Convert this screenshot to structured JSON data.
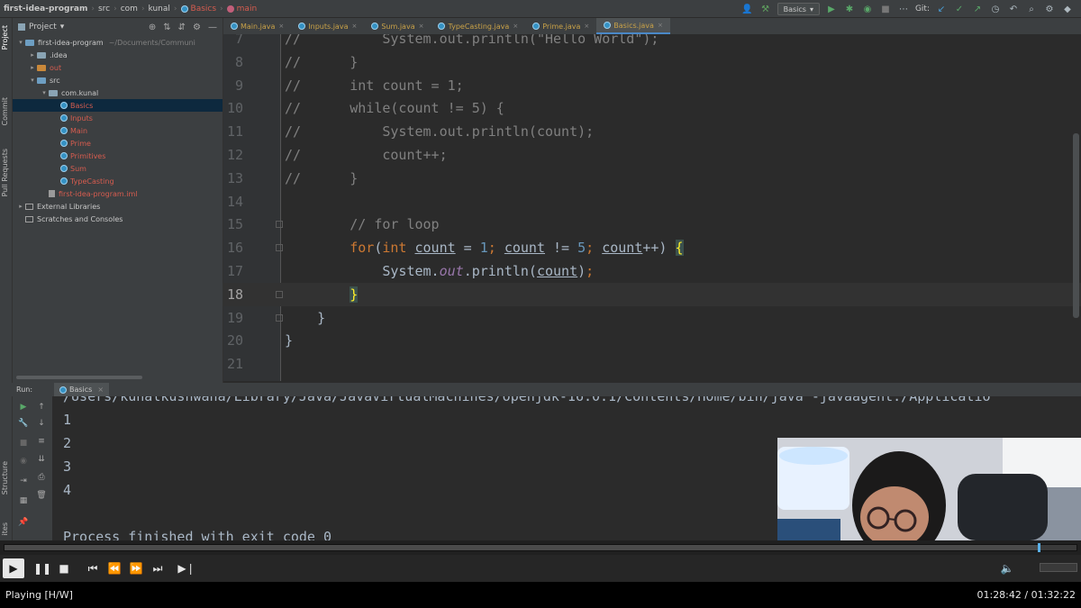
{
  "navbar": {
    "crumbs": [
      "first-idea-program",
      "src",
      "com",
      "kunal",
      "Basics",
      "main"
    ],
    "run_config": "Basics",
    "git_label": "Git:"
  },
  "project_panel": {
    "title": "Project",
    "tree": [
      {
        "label": "first-idea-program",
        "extra": "~/Documents/Communi",
        "depth": 0,
        "kind": "folder-blue",
        "arrow": "v"
      },
      {
        "label": ".idea",
        "depth": 1,
        "kind": "folder",
        "arrow": ">"
      },
      {
        "label": "out",
        "depth": 1,
        "kind": "folder-orange",
        "arrow": ">",
        "color": "#d65c4f"
      },
      {
        "label": "src",
        "depth": 1,
        "kind": "folder-blue",
        "arrow": "v"
      },
      {
        "label": "com.kunal",
        "depth": 2,
        "kind": "folder",
        "arrow": "v"
      },
      {
        "label": "Basics",
        "depth": 3,
        "kind": "class",
        "selected": true,
        "color": "#d65c4f"
      },
      {
        "label": "Inputs",
        "depth": 3,
        "kind": "class",
        "color": "#d65c4f"
      },
      {
        "label": "Main",
        "depth": 3,
        "kind": "class",
        "color": "#d65c4f"
      },
      {
        "label": "Prime",
        "depth": 3,
        "kind": "class",
        "color": "#d65c4f"
      },
      {
        "label": "Primitives",
        "depth": 3,
        "kind": "class",
        "color": "#d65c4f"
      },
      {
        "label": "Sum",
        "depth": 3,
        "kind": "class",
        "color": "#d65c4f"
      },
      {
        "label": "TypeCasting",
        "depth": 3,
        "kind": "class",
        "color": "#d65c4f"
      },
      {
        "label": "first-idea-program.iml",
        "depth": 2,
        "kind": "iml",
        "color": "#d65c4f"
      },
      {
        "label": "External Libraries",
        "depth": 0,
        "kind": "lib",
        "arrow": ">"
      },
      {
        "label": "Scratches and Consoles",
        "depth": 0,
        "kind": "lib",
        "arrow": ""
      }
    ]
  },
  "left_strip": {
    "project_tab": "Project",
    "commit_tab": "Commit",
    "pull_tab": "Pull Requests",
    "structure_tab": "Structure",
    "favorites_tab": "ites"
  },
  "editor": {
    "tabs": [
      "Main.java",
      "Inputs.java",
      "Sum.java",
      "TypeCasting.java",
      "Prime.java",
      "Basics.java"
    ],
    "active_tab": 5,
    "lines": [
      {
        "n": "7",
        "parts": [
          [
            "cmt",
            "//          System.out.println(\"Hello World\");"
          ]
        ]
      },
      {
        "n": "8",
        "parts": [
          [
            "cmt",
            "//      }"
          ]
        ]
      },
      {
        "n": "9",
        "parts": [
          [
            "cmt",
            "//      int count = 1;"
          ]
        ]
      },
      {
        "n": "10",
        "parts": [
          [
            "cmt",
            "//      while(count != 5) {"
          ]
        ]
      },
      {
        "n": "11",
        "parts": [
          [
            "cmt",
            "//          System.out.println(count);"
          ]
        ]
      },
      {
        "n": "12",
        "parts": [
          [
            "cmt",
            "//          count++;"
          ]
        ]
      },
      {
        "n": "13",
        "parts": [
          [
            "cmt",
            "//      }"
          ]
        ]
      },
      {
        "n": "14",
        "parts": []
      },
      {
        "n": "15",
        "parts": [
          [
            "pl",
            "        "
          ],
          [
            "cmt",
            "// for loop"
          ]
        ]
      },
      {
        "n": "16",
        "parts": [
          [
            "pl",
            "        "
          ],
          [
            "kw",
            "for"
          ],
          [
            "pl",
            "("
          ],
          [
            "kw",
            "int "
          ],
          [
            "ul",
            "count"
          ],
          [
            "pl",
            " = "
          ],
          [
            "num",
            "1"
          ],
          [
            "kw",
            "; "
          ],
          [
            "ul",
            "count"
          ],
          [
            "pl",
            " != "
          ],
          [
            "num",
            "5"
          ],
          [
            "kw",
            "; "
          ],
          [
            "ul",
            "count"
          ],
          [
            "pl",
            "++) "
          ],
          [
            "br",
            "{"
          ]
        ]
      },
      {
        "n": "17",
        "parts": [
          [
            "pl",
            "            System."
          ],
          [
            "fld",
            "out"
          ],
          [
            "pl",
            ".println("
          ],
          [
            "ul",
            "count"
          ],
          [
            "pl",
            ")"
          ],
          [
            "kw",
            ";"
          ]
        ]
      },
      {
        "n": "18",
        "parts": [
          [
            "pl",
            "        "
          ],
          [
            "br",
            "}"
          ]
        ],
        "current": true
      },
      {
        "n": "19",
        "parts": [
          [
            "pl",
            "    }"
          ]
        ]
      },
      {
        "n": "20",
        "parts": [
          [
            "pl",
            "}"
          ]
        ]
      },
      {
        "n": "21",
        "parts": []
      }
    ]
  },
  "run_panel": {
    "label": "Run:",
    "tab": "Basics",
    "command": "/Users/kunalkushwaha/Library/Java/JavaVirtualMachines/openjdk-16.0.1/Contents/Home/bin/java -javaagent:/Applicatio",
    "output": [
      "1",
      "2",
      "3",
      "4",
      "",
      "Process finished with exit code 0"
    ]
  },
  "player": {
    "progress": 0.9637,
    "status": "Playing [H/W]",
    "time": "01:28:42 / 01:32:22",
    "volume": 0
  }
}
